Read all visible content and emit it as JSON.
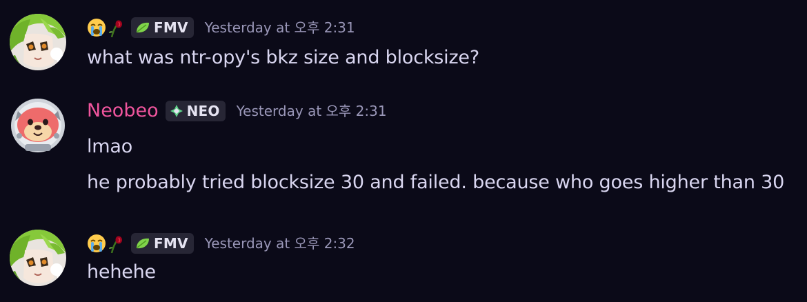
{
  "messages": [
    {
      "author": "",
      "author_emojis": [
        "sob-emoji",
        "wilted-rose-emoji"
      ],
      "role": {
        "label": "FMV",
        "icon": "leaf-icon",
        "color": "#7fd34a"
      },
      "timestamp": "Yesterday at 오후 2:31",
      "lines": [
        "what was ntr-opy's bkz size and blocksize?"
      ]
    },
    {
      "author": "Neobeo",
      "author_color": "#f0559d",
      "role": {
        "label": "NEO",
        "icon": "sparkle-diamond-icon",
        "color": "#5fd38a"
      },
      "timestamp": "Yesterday at 오후 2:31",
      "lines": [
        "lmao",
        "he probably tried blocksize 30 and failed. because who goes higher than 30"
      ]
    },
    {
      "author": "",
      "author_emojis": [
        "sob-emoji",
        "wilted-rose-emoji"
      ],
      "role": {
        "label": "FMV",
        "icon": "leaf-icon",
        "color": "#7fd34a"
      },
      "timestamp": "Yesterday at 오후 2:32",
      "lines": [
        "hehehe"
      ]
    }
  ]
}
